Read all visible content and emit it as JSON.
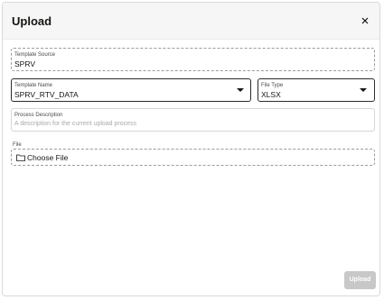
{
  "dialog": {
    "title": "Upload",
    "close_icon": "close-icon"
  },
  "template_source": {
    "label": "Template Source",
    "value": "SPRV"
  },
  "template_name": {
    "label": "Template Name",
    "value": "SPRV_RTV_DATA",
    "icon": "chevron-down-icon"
  },
  "file_type": {
    "label": "File Type",
    "value": "XLSX",
    "icon": "chevron-down-icon"
  },
  "process_description": {
    "label": "Process Description",
    "placeholder": "A description for the current upload process"
  },
  "file": {
    "label": "File",
    "choose_label": "Choose File",
    "icon": "folder-icon"
  },
  "actions": {
    "upload_label": "Upload"
  }
}
